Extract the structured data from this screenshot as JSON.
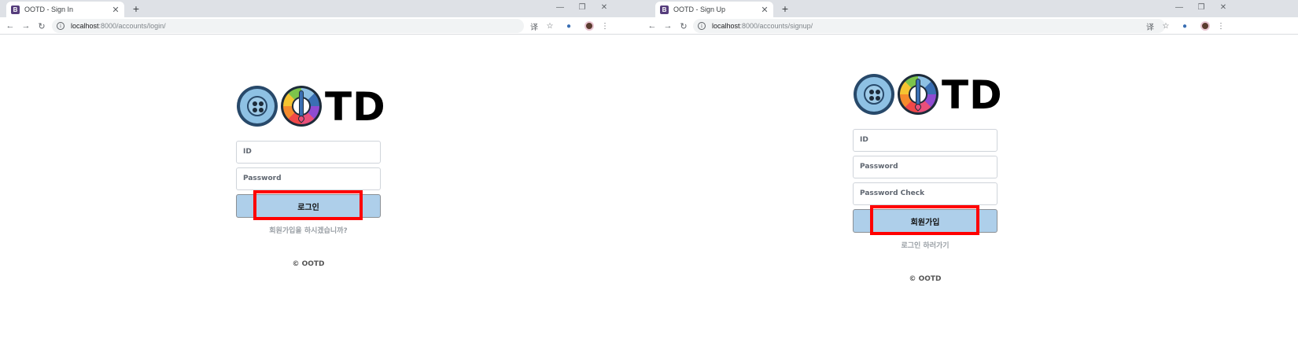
{
  "login_window": {
    "tab_title": "OOTD - Sign In",
    "favicon_letter": "B",
    "url_host": "localhost",
    "url_path": ":8000/accounts/login/",
    "logo_text": "TD",
    "id_placeholder": "ID",
    "password_placeholder": "Password",
    "submit_label": "로그인",
    "link_text": "회원가입을 하시겠습니까?",
    "footer": "© OOTD"
  },
  "signup_window": {
    "tab_title": "OOTD - Sign Up",
    "favicon_letter": "B",
    "url_host": "localhost",
    "url_path": ":8000/accounts/signup/",
    "logo_text": "TD",
    "id_placeholder": "ID",
    "password_placeholder": "Password",
    "password_check_placeholder": "Password Check",
    "submit_label": "회원가입",
    "link_text": "로그인 하러가기",
    "footer": "© OOTD"
  },
  "icons": {
    "close": "✕",
    "new_tab": "+",
    "minimize": "—",
    "restore": "❐",
    "window_close": "✕",
    "back": "←",
    "forward": "→",
    "reload": "↻",
    "info": "i",
    "translate": "译",
    "star": "☆",
    "extension": "●",
    "menu": "⋮"
  },
  "colors": {
    "submit_bg": "#aecfea",
    "highlight": "#ff0000",
    "tab_strip": "#dee1e6"
  }
}
